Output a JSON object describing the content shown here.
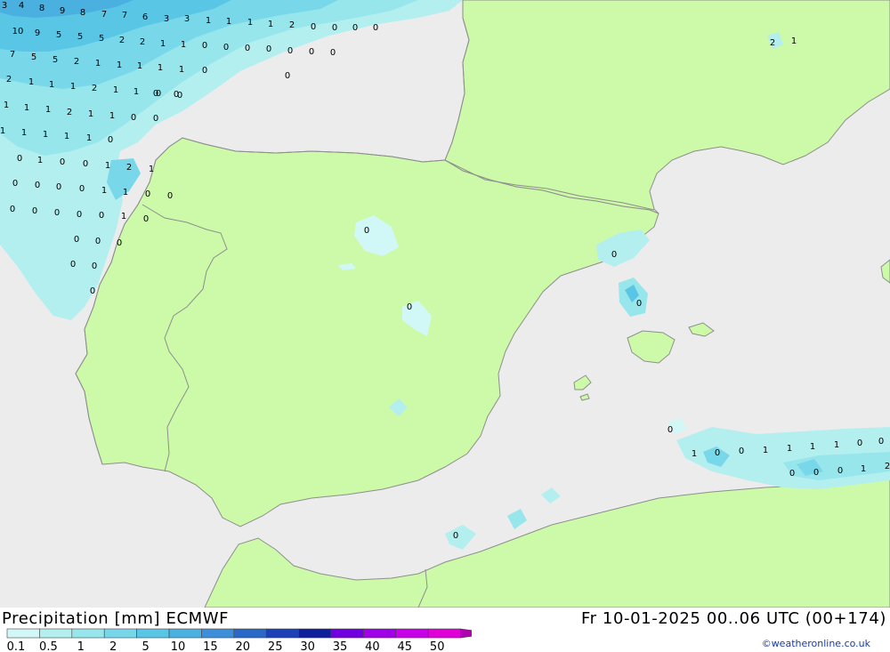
{
  "title": {
    "left": "Precipitation [mm] ECMWF",
    "right": "Fr 10-01-2025 00..06 UTC (00+174)"
  },
  "credit": "©weatheronline.co.uk",
  "legend": {
    "labels": [
      "0.1",
      "0.5",
      "1",
      "2",
      "5",
      "10",
      "15",
      "20",
      "25",
      "30",
      "35",
      "40",
      "45",
      "50"
    ],
    "colors": [
      "#d2f7f7",
      "#b4eff0",
      "#96e6ec",
      "#78d8ea",
      "#5ac6e6",
      "#4ab0e0",
      "#3c8fd8",
      "#2a68c8",
      "#1c40b8",
      "#10209c",
      "#7000e0",
      "#a000e8",
      "#c800e8",
      "#e000d8",
      "#b000b0"
    ]
  },
  "map": {
    "colors": {
      "sea": "#ececec",
      "land": "#ccfaa8",
      "coast": "#8e8e8e"
    },
    "values": [
      "3",
      "4",
      "8",
      "9",
      "8",
      "7",
      "7",
      "6",
      "3",
      "3",
      "1",
      "1",
      "1",
      "1",
      "2",
      "0",
      "0",
      "0",
      "0",
      "10",
      "9",
      "5",
      "5",
      "5",
      "2",
      "2",
      "1",
      "1",
      "0",
      "0",
      "0",
      "0",
      "0",
      "0",
      "0",
      "0",
      "7",
      "5",
      "5",
      "2",
      "1",
      "1",
      "1",
      "1",
      "1",
      "0",
      "0",
      "0",
      "2",
      "1",
      "1",
      "1",
      "2",
      "1",
      "1",
      "0",
      "0",
      "1",
      "1",
      "1",
      "2",
      "1",
      "1",
      "0",
      "0",
      "1",
      "1",
      "1",
      "1",
      "1",
      "0",
      "0",
      "1",
      "0",
      "0",
      "1",
      "2",
      "1",
      "0",
      "0",
      "0",
      "0",
      "1",
      "1",
      "0",
      "0",
      "0",
      "0",
      "0",
      "0",
      "0",
      "1",
      "0",
      "0",
      "0",
      "0",
      "0",
      "0",
      "0",
      "0",
      "0",
      "0",
      "0",
      "0",
      "1",
      "0",
      "0",
      "1",
      "1",
      "1",
      "1",
      "0",
      "0",
      "0",
      "0",
      "0",
      "1",
      "2",
      "0",
      "2",
      "1",
      "0",
      "0",
      "3",
      "5",
      "0"
    ]
  }
}
